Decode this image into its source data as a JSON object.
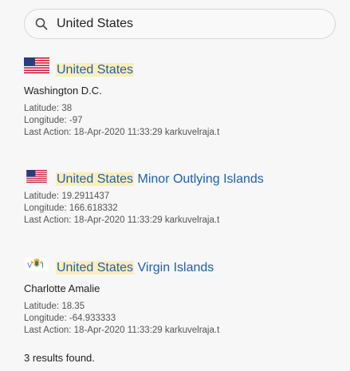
{
  "search": {
    "value": "United States",
    "icon": "search-icon"
  },
  "results": [
    {
      "flag": "us-flag",
      "highlight": "United States",
      "title_rest": "",
      "capital": "Washington D.C.",
      "latitude": "Latitude: 38",
      "longitude": "Longitude: -97",
      "last_action": "Last Action: 18-Apr-2020 11:33:29 karkuvelraja.t"
    },
    {
      "flag": "us-flag",
      "highlight": "United States",
      "title_rest": " Minor Outlying Islands",
      "capital": "",
      "latitude": "Latitude: 19.2911437",
      "longitude": "Longitude: 166.618332",
      "last_action": "Last Action: 18-Apr-2020 11:33:29 karkuvelraja.t"
    },
    {
      "flag": "usvi-flag",
      "highlight": "United States",
      "title_rest": " Virgin Islands",
      "capital": "Charlotte Amalie",
      "latitude": "Latitude: 18.35",
      "longitude": "Longitude: -64.933333",
      "last_action": "Last Action: 18-Apr-2020 11:33:29 karkuvelraja.t"
    }
  ],
  "summary": "3 results found.",
  "colors": {
    "link": "#1f5fb4",
    "highlight": "#fbeeb8"
  }
}
